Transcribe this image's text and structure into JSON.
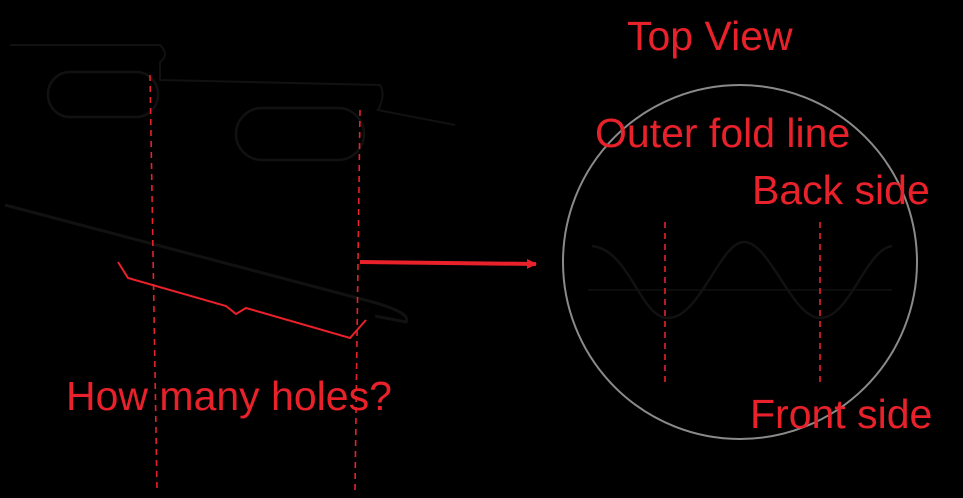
{
  "labels": {
    "question": "How many holes?",
    "top_view": "Top View",
    "outer_fold_line": "Outer fold line",
    "back_side": "Back side",
    "front_side": "Front side"
  },
  "colors": {
    "background": "#000000",
    "annotation": "#e8212a",
    "outline": "#111111",
    "circle": "#8a8a8a"
  }
}
